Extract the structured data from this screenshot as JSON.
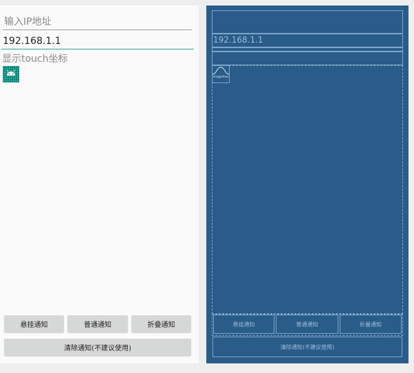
{
  "preview": {
    "ip_hint": "输入IP地址",
    "ip_value": "192.168.1.1",
    "touch_label": "显示touch坐标",
    "buttons": {
      "hover": "悬挂通知",
      "normal": "普通通知",
      "fold": "折叠通知",
      "clear": "清除通知(不建议使用)"
    }
  },
  "blueprint": {
    "ip_value": "192.168.1.1",
    "image_label": "ImageView",
    "buttons": {
      "hover": "悬挂通知",
      "normal": "普通通知",
      "fold": "折叠通知",
      "clear": "清除通知(不建议使用)"
    }
  },
  "colors": {
    "accent": "#26a69a",
    "image_bg": "#008577",
    "blueprint_bg": "#2a5c8a",
    "blueprint_line": "#7ea6cc"
  }
}
